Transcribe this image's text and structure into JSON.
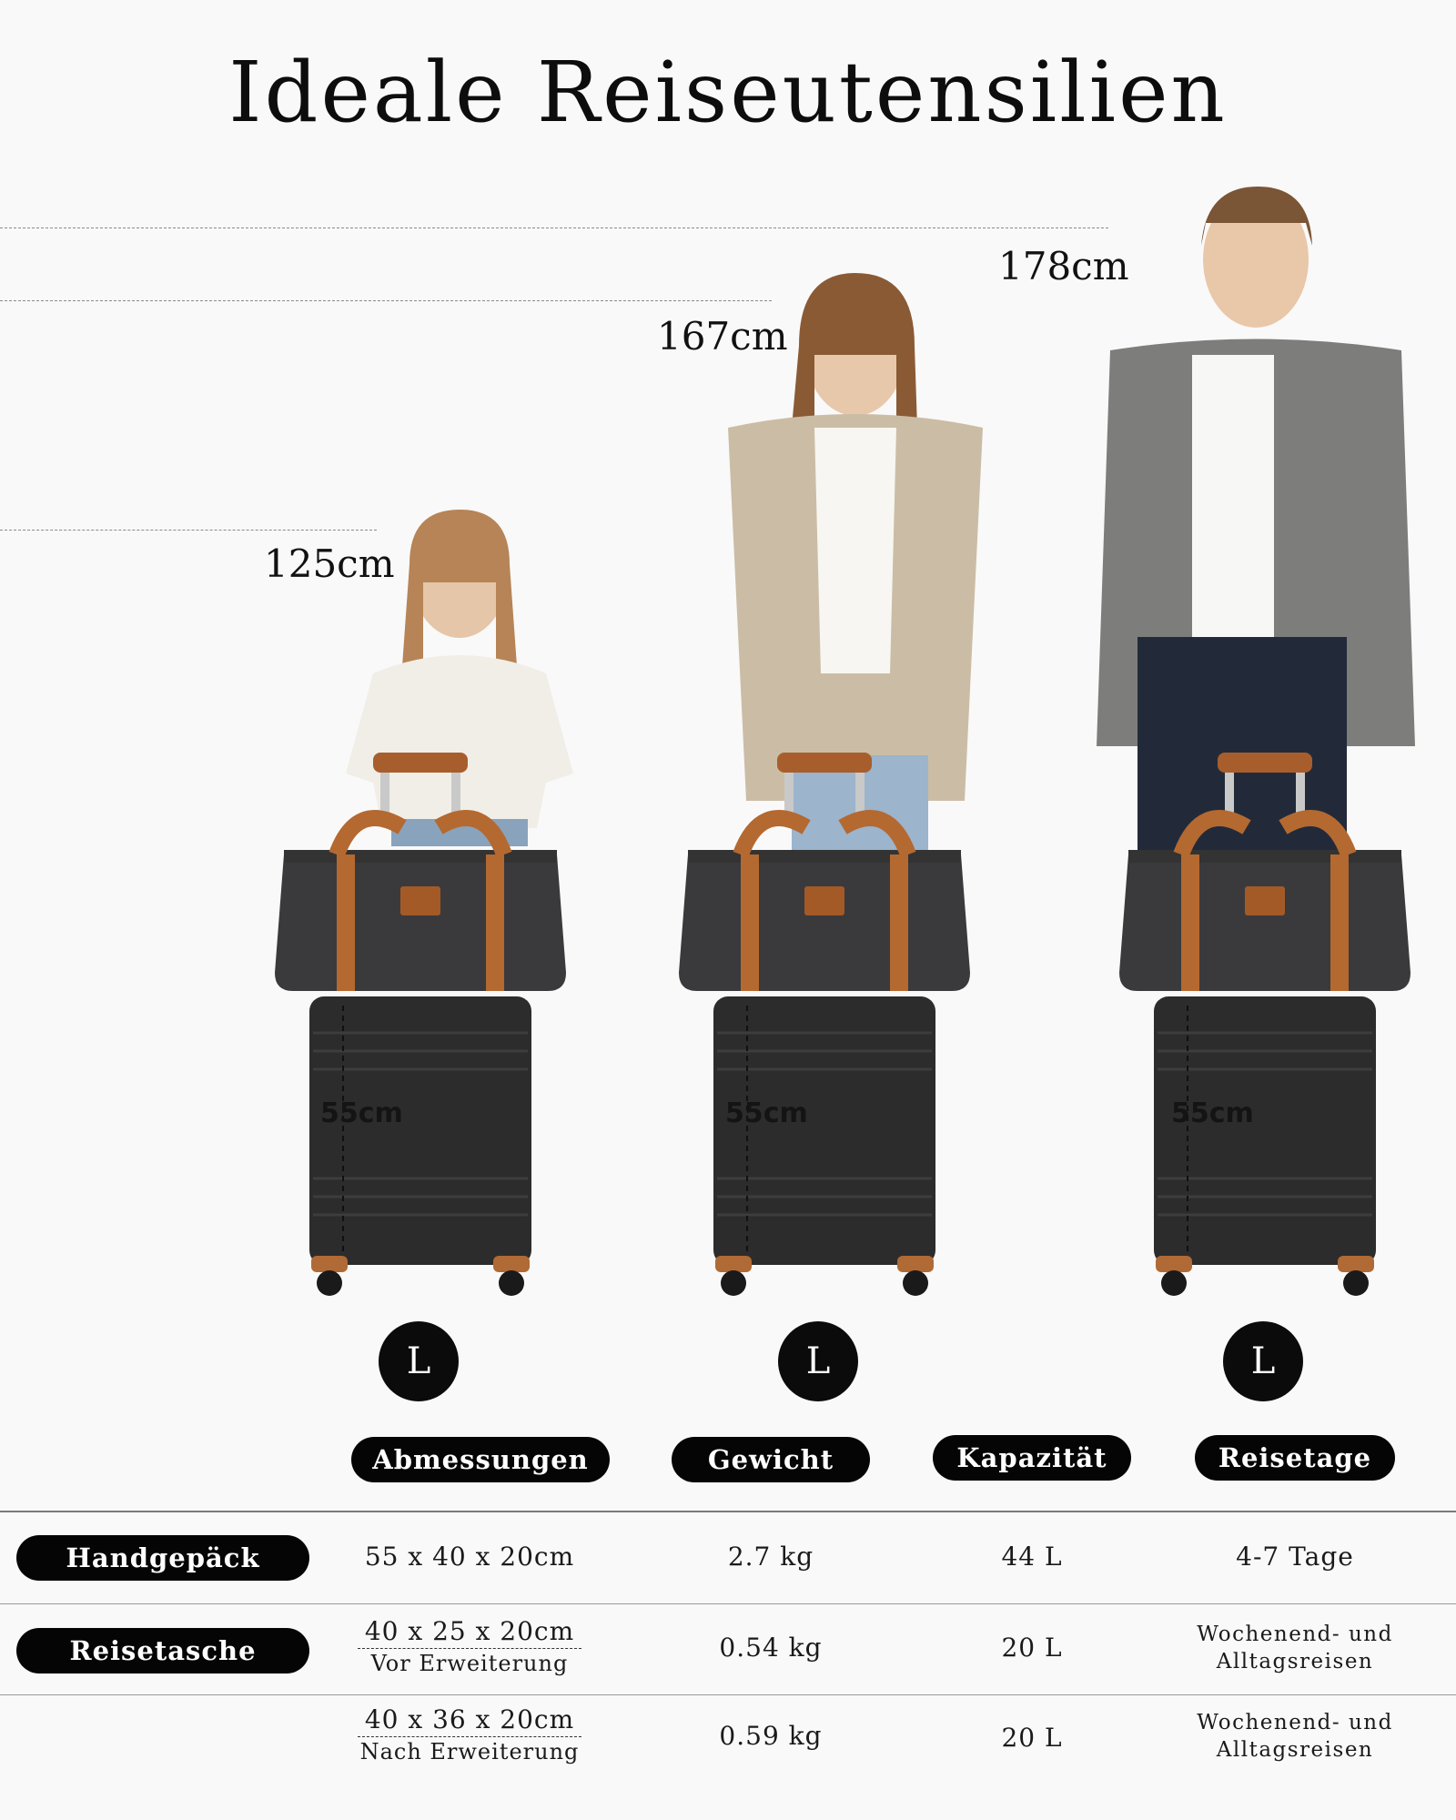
{
  "title": "Ideale Reiseutensilien",
  "heights": [
    {
      "label": "125cm"
    },
    {
      "label": "167cm"
    },
    {
      "label": "178cm"
    }
  ],
  "luggage_height_label": "55cm",
  "size_badges": [
    "L",
    "L",
    "L"
  ],
  "table": {
    "columns": [
      "Abmessungen",
      "Gewicht",
      "Kapazität",
      "Reisetage"
    ],
    "rows": [
      {
        "label": "Handgepäck",
        "dimensions": "55 x 40 x 20cm",
        "dimensions_note": "",
        "weight": "2.7 kg",
        "capacity": "44 L",
        "days": "4-7 Tage"
      },
      {
        "label": "Reisetasche",
        "dimensions": "40 x 25 x 20cm",
        "dimensions_note": "Vor Erweiterung",
        "weight": "0.54 kg",
        "capacity": "20 L",
        "days_line1": "Wochenend- und",
        "days_line2": "Alltagsreisen"
      },
      {
        "label": "",
        "dimensions": "40 x 36 x 20cm",
        "dimensions_note": "Nach Erweiterung",
        "weight": "0.59 kg",
        "capacity": "20 L",
        "days_line1": "Wochenend- und",
        "days_line2": "Alltagsreisen"
      }
    ]
  },
  "colors": {
    "background": "#f9f9f9",
    "pill": "#050505",
    "luggage": "#2e2e2e",
    "bag": "#3b3b3d",
    "strap": "#b86b34"
  }
}
